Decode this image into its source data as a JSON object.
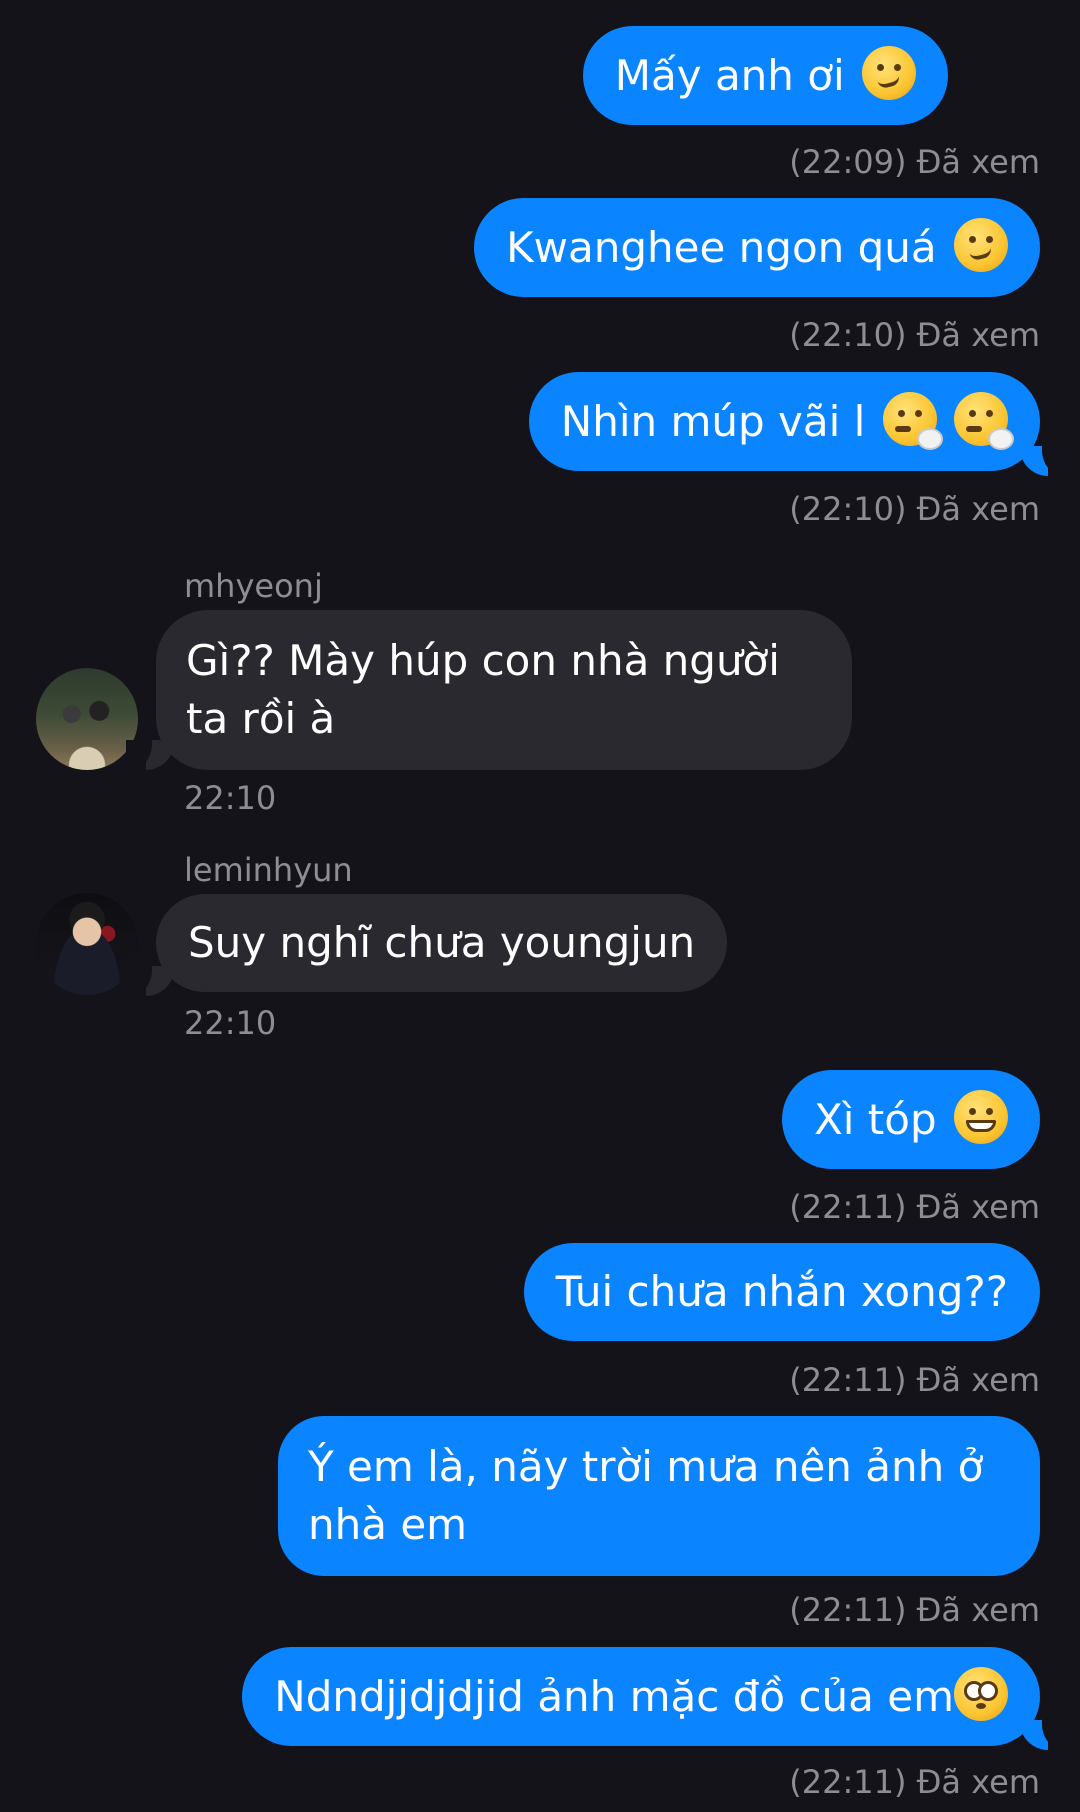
{
  "messages": [
    {
      "id": "m1",
      "text": "Mấy anh ơi",
      "emojis": [
        "drooling-face"
      ],
      "status": "(22:09) Đã xem"
    },
    {
      "id": "m2",
      "text": "Kwanghee ngon quá",
      "emojis": [
        "woozy-face"
      ],
      "status": "(22:10) Đã xem"
    },
    {
      "id": "m3",
      "text": "Nhìn múp vãi l",
      "emojis": [
        "face-with-steam",
        "face-with-steam"
      ],
      "status": "(22:10) Đã xem"
    },
    {
      "id": "r1",
      "sender": "mhyeonj",
      "line1": "Gì?? Mày húp con nhà người",
      "line2": "ta rồi à",
      "time": "22:10"
    },
    {
      "id": "r2",
      "sender": "leminhyun",
      "text": "Suy nghĩ chưa youngjun",
      "time": "22:10"
    },
    {
      "id": "m4",
      "text": "Xì tóp",
      "emojis": [
        "grinning-face"
      ],
      "status": "(22:11) Đã xem"
    },
    {
      "id": "m5",
      "text": "Tui chưa nhắn xong??",
      "status": "(22:11) Đã xem"
    },
    {
      "id": "m6",
      "line1": "Ý em là, nãy trời mưa nên ảnh ở",
      "line2": "nhà em",
      "status": "(22:11) Đã xem"
    },
    {
      "id": "m7",
      "text": "Ndndjjdjdjid ảnh mặc đồ của em",
      "emojis": [
        "flushed-face"
      ],
      "status": "(22:11) Đã xem"
    }
  ],
  "colors": {
    "background": "#141319",
    "outgoing_bubble": "#0a84ff",
    "incoming_bubble": "#2a292f",
    "meta_text": "#8e8d93"
  }
}
